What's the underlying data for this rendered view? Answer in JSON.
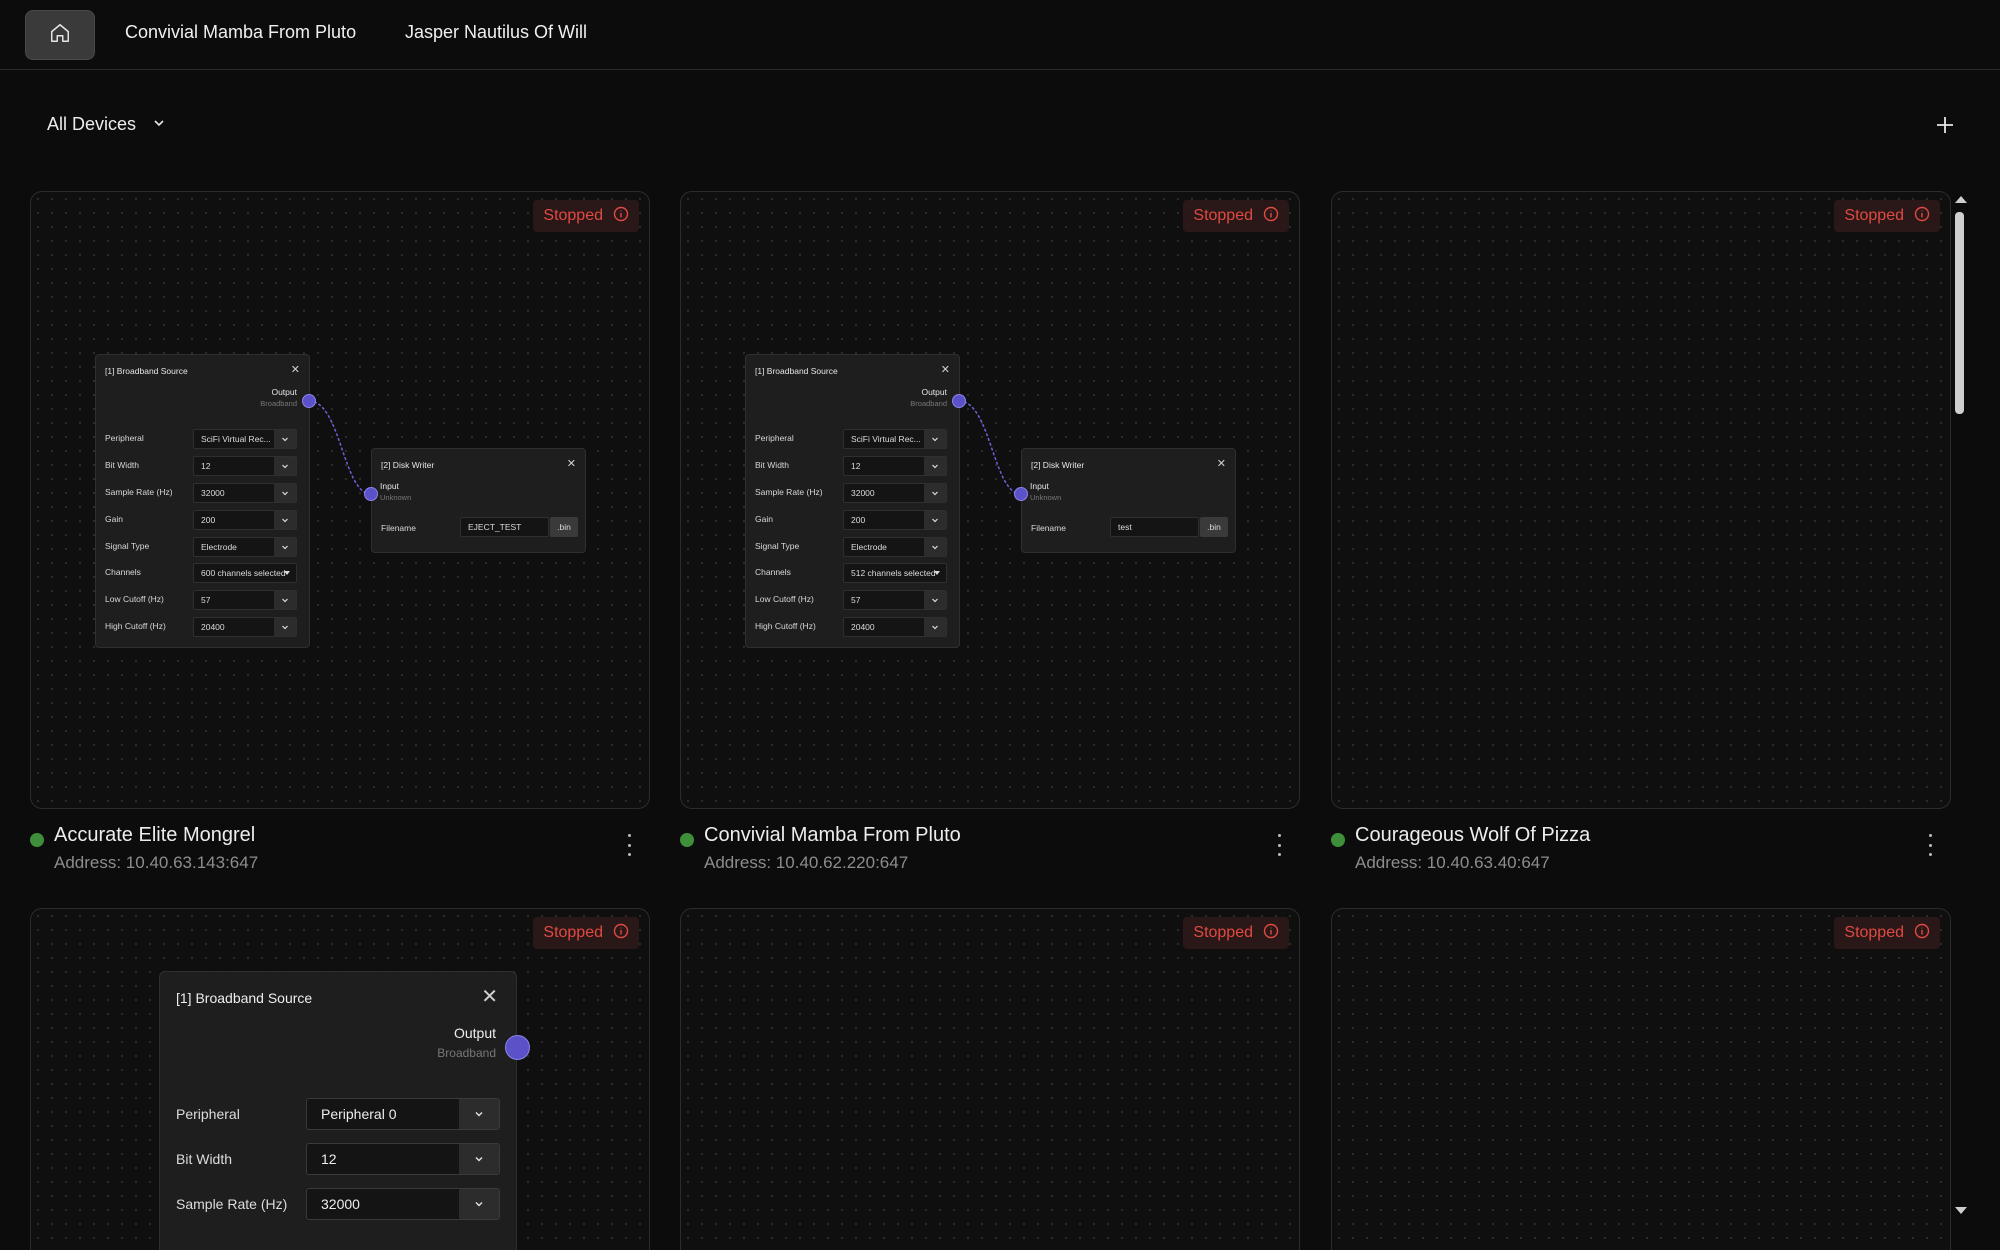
{
  "nav": {
    "home_icon": "home-icon",
    "tabs": [
      "Convivial Mamba From Pluto",
      "Jasper Nautilus Of Will"
    ]
  },
  "filter": {
    "label": "All Devices"
  },
  "colors": {
    "background": "#0c0c0c",
    "status_stopped": "#e04a42",
    "online_dot": "#3f8f3a",
    "port": "#5b52c9"
  },
  "devices": [
    {
      "name": "Accurate Elite Mongrel",
      "address": "Address: 10.40.63.143:647",
      "status": "Stopped",
      "source": {
        "title": "[1] Broadband Source",
        "output": "Output",
        "output_sub": "Broadband",
        "rows": [
          {
            "label": "Peripheral",
            "value": "SciFi Virtual Rec..."
          },
          {
            "label": "Bit Width",
            "value": "12"
          },
          {
            "label": "Sample Rate (Hz)",
            "value": "32000"
          },
          {
            "label": "Gain",
            "value": "200"
          },
          {
            "label": "Signal Type",
            "value": "Electrode"
          },
          {
            "label": "Channels",
            "value": "600 channels selected"
          },
          {
            "label": "Low Cutoff (Hz)",
            "value": "57"
          },
          {
            "label": "High Cutoff (Hz)",
            "value": "20400"
          }
        ]
      },
      "writer": {
        "title": "[2] Disk Writer",
        "input": "Input",
        "input_sub": "Unknown",
        "filename_label": "Filename",
        "filename": "EJECT_TEST",
        "ext": ".bin"
      }
    },
    {
      "name": "Convivial Mamba From Pluto",
      "address": "Address: 10.40.62.220:647",
      "status": "Stopped",
      "source": {
        "title": "[1] Broadband Source",
        "output": "Output",
        "output_sub": "Broadband",
        "rows": [
          {
            "label": "Peripheral",
            "value": "SciFi Virtual Rec..."
          },
          {
            "label": "Bit Width",
            "value": "12"
          },
          {
            "label": "Sample Rate (Hz)",
            "value": "32000"
          },
          {
            "label": "Gain",
            "value": "200"
          },
          {
            "label": "Signal Type",
            "value": "Electrode"
          },
          {
            "label": "Channels",
            "value": "512 channels selected"
          },
          {
            "label": "Low Cutoff (Hz)",
            "value": "57"
          },
          {
            "label": "High Cutoff (Hz)",
            "value": "20400"
          }
        ]
      },
      "writer": {
        "title": "[2] Disk Writer",
        "input": "Input",
        "input_sub": "Unknown",
        "filename_label": "Filename",
        "filename": "test",
        "ext": ".bin"
      }
    },
    {
      "name": "Courageous Wolf Of Pizza",
      "address": "Address: 10.40.63.40:647",
      "status": "Stopped"
    },
    {
      "status": "Stopped",
      "source": {
        "title": "[1] Broadband Source",
        "output": "Output",
        "output_sub": "Broadband",
        "rows": [
          {
            "label": "Peripheral",
            "value": "Peripheral 0"
          },
          {
            "label": "Bit Width",
            "value": "12"
          },
          {
            "label": "Sample Rate (Hz)",
            "value": "32000"
          }
        ]
      }
    },
    {
      "status": "Stopped"
    },
    {
      "status": "Stopped"
    }
  ]
}
